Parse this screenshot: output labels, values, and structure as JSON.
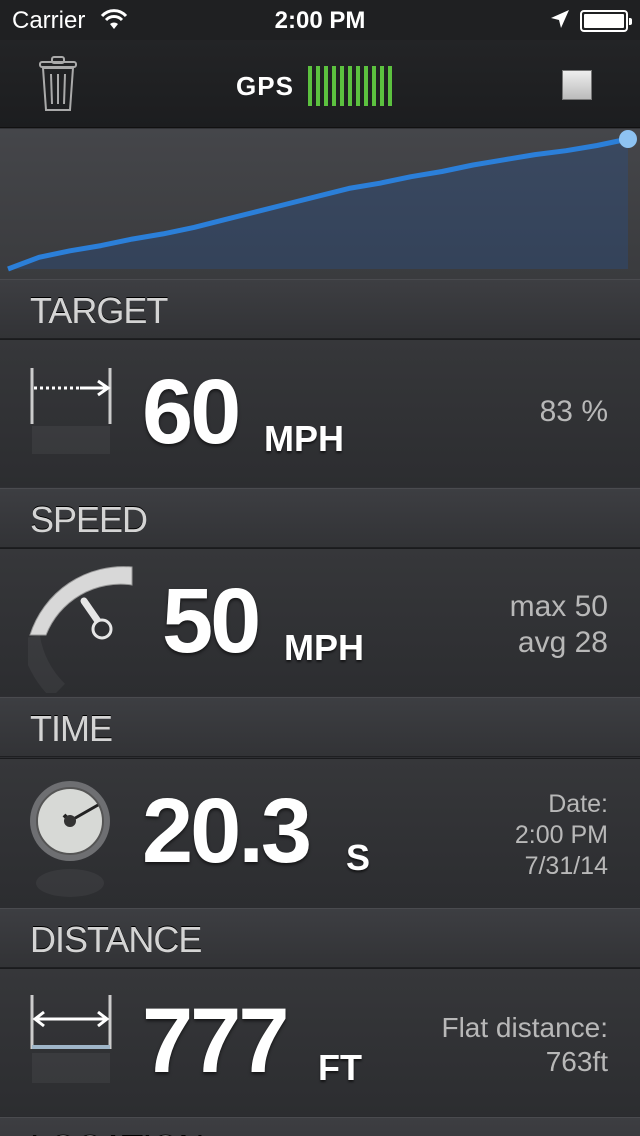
{
  "status_bar": {
    "carrier": "Carrier",
    "time": "2:00 PM"
  },
  "toolbar": {
    "gps_label": "GPS",
    "gps_bars": 11,
    "gps_color": "#5cc13f"
  },
  "chart_data": {
    "type": "area",
    "x": [
      0,
      1,
      2,
      3,
      4,
      5,
      6,
      7,
      8,
      9,
      10,
      11,
      12,
      13,
      14,
      15,
      16,
      17,
      18,
      19,
      20
    ],
    "y": [
      0,
      0.09,
      0.14,
      0.18,
      0.23,
      0.27,
      0.32,
      0.38,
      0.44,
      0.5,
      0.56,
      0.62,
      0.66,
      0.71,
      0.75,
      0.8,
      0.84,
      0.88,
      0.91,
      0.95,
      1.0
    ],
    "line_color": "#2b7fd9",
    "marker": "last-point",
    "grid": false
  },
  "sections": {
    "target": {
      "title": "TARGET",
      "value": "60",
      "unit": "MPH",
      "side": "83 %"
    },
    "speed": {
      "title": "SPEED",
      "value": "50",
      "unit": "MPH",
      "side_max": "max 50",
      "side_avg": "avg 28"
    },
    "time": {
      "title": "TIME",
      "value": "20.3",
      "unit": "S",
      "side_label": "Date:",
      "side_time": "2:00 PM",
      "side_date": "7/31/14"
    },
    "distance": {
      "title": "DISTANCE",
      "value": "777",
      "unit": "FT",
      "side_label": "Flat distance:",
      "side_value": "763ft"
    },
    "location": {
      "title": "LOCATION"
    }
  }
}
